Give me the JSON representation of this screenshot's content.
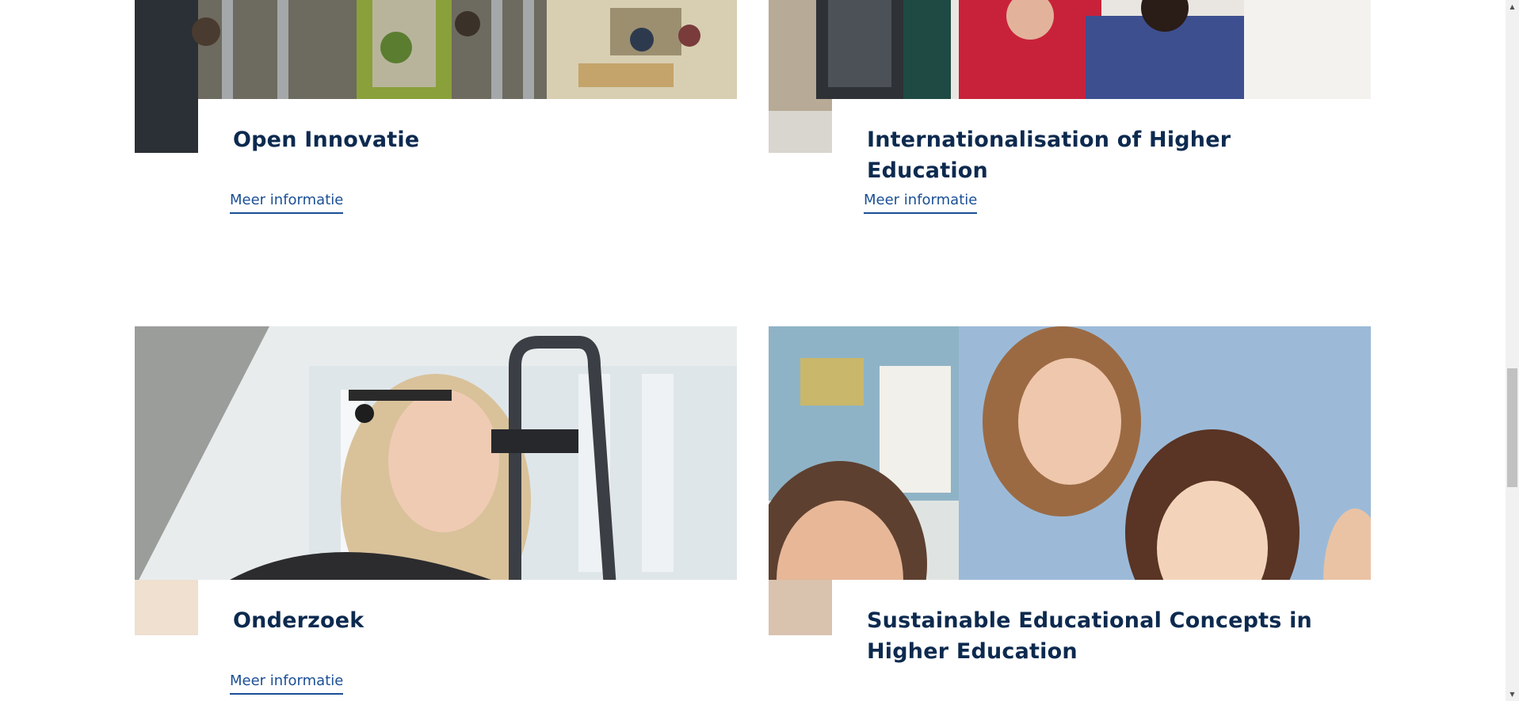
{
  "cards": [
    {
      "title": "Open Innovatie",
      "link_label": "Meer informatie",
      "image_subject": "open-plan office with people working at desks"
    },
    {
      "title": "Internationalisation of Higher Education",
      "link_label": "Meer informatie",
      "image_subject": "students studying together at a computer"
    },
    {
      "title": "Onderzoek",
      "link_label": "Meer informatie",
      "image_subject": "woman wearing eye-tracking headset"
    },
    {
      "title": "Sustainable Educational Concepts in Higher Education",
      "link_label": "",
      "image_subject": "teacher helping smiling students in a classroom"
    }
  ],
  "scrollbar": {
    "up_icon": "scroll-up-arrow-icon",
    "down_icon": "scroll-down-arrow-icon"
  },
  "colors": {
    "title": "#0d2a4f",
    "link": "#1b4f95",
    "background": "#ffffff"
  }
}
